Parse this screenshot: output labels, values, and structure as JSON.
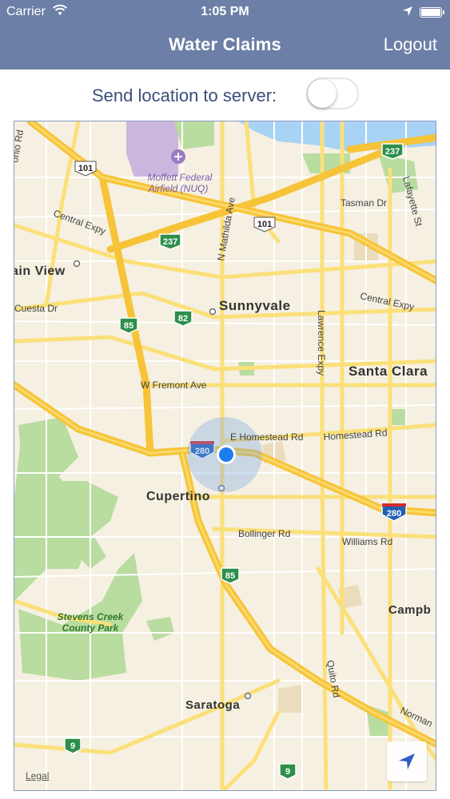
{
  "status_bar": {
    "carrier": "Carrier",
    "time": "1:05 PM",
    "icons": [
      "wifi-icon",
      "location-arrow-icon",
      "battery-icon"
    ]
  },
  "nav": {
    "title": "Water Claims",
    "logout_label": "Logout"
  },
  "toggle": {
    "label": "Send location to server:",
    "on": false
  },
  "map": {
    "legal_label": "Legal",
    "cities": [
      "Sunnyvale",
      "Santa Clara",
      "Cupertino",
      "Saratoga",
      "Campb",
      "ain View"
    ],
    "streets": [
      "Central Expy",
      "Central Expy",
      "Cuesta Dr",
      "W Fremont Ave",
      "E Homestead Rd",
      "Homestead Rd",
      "Bollinger Rd",
      "Williams Rd",
      "Tasman Dr",
      "Lawrence Expy",
      "N Mathilda Ave",
      "Lafayette St",
      "Quito Rd",
      "Norman",
      "onio Rd"
    ],
    "places": {
      "airfield": "Moffett Federal Airfield (NUQ)",
      "park": "Stevens Creek County Park"
    },
    "highway_shields": [
      "101",
      "101",
      "237",
      "237",
      "85",
      "85",
      "82",
      "280",
      "280",
      "9",
      "9"
    ],
    "colors": {
      "nav": "#6c7fa6",
      "land": "#f5f0e1",
      "highway": "#f7c338",
      "park": "#b9dca0",
      "water": "#a9d3f5",
      "user_dot": "#1d7cf2"
    }
  }
}
